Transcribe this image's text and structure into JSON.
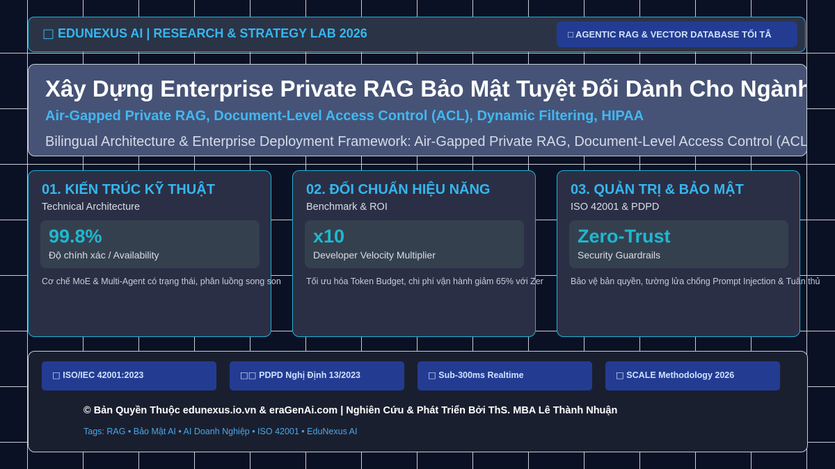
{
  "header": {
    "brand_icon": "□",
    "brand_text": "EDUNEXUS AI | RESEARCH & STRATEGY LAB 2026",
    "pill_text": "□ AGENTIC RAG & VECTOR DATABASE TỐI TÂ"
  },
  "hero": {
    "title": "Xây Dựng Enterprise Private RAG Bảo Mật Tuyệt Đối Dành Cho Ngành",
    "subtitle": "Air-Gapped Private RAG, Document-Level Access Control (ACL), Dynamic Filtering, HIPAA",
    "description": "Bilingual Architecture & Enterprise Deployment Framework: Air-Gapped Private RAG, Document-Level Access Control (ACL), Dy"
  },
  "cards": [
    {
      "title": "01. KIẾN TRÚC KỸ THUẬT",
      "subtitle": "Technical Architecture",
      "metric_value": "99.8%",
      "metric_label": "Độ chính xác / Availability",
      "description": "Cơ chế MoE & Multi-Agent có trạng thái, phân luồng song son"
    },
    {
      "title": "02. ĐỐI CHUẨN HIỆU NĂNG",
      "subtitle": "Benchmark & ROI",
      "metric_value": "x10",
      "metric_label": "Developer Velocity Multiplier",
      "description": "Tối ưu hóa Token Budget, chi phí vận hành giảm 65% với Zer"
    },
    {
      "title": "03. QUẢN TRỊ & BẢO MẬT",
      "subtitle": "ISO 42001 & PDPD",
      "metric_value": "Zero-Trust",
      "metric_label": "Security Guardrails",
      "description": "Bảo vệ bản quyền, tường lửa chống Prompt Injection & Tuân thủ"
    }
  ],
  "footer": {
    "chips": [
      {
        "icon": "□",
        "label": "ISO/IEC 42001:2023"
      },
      {
        "icon": "□□",
        "label": "PDPD Nghị Định 13/2023"
      },
      {
        "icon": "□",
        "label": "Sub-300ms Realtime"
      },
      {
        "icon": "□",
        "label": "SCALE Methodology 2026"
      }
    ],
    "copyright": "© Bản Quyền Thuộc edunexus.io.vn & eraGenAi.com | Nghiên Cứu & Phát Triển Bởi ThS. MBA Lê Thành Nhuận",
    "tags": "Tags: RAG • Bảo Mật AI • AI Doanh Nghiệp • ISO 42001 • EduNexus AI"
  },
  "colors": {
    "background": "#0b1124",
    "accent_cyan": "#35b6ef",
    "metric_teal": "#1fb8cf",
    "pill_blue": "#233c92",
    "hero_panel": "#465376",
    "card_panel": "#2a2f45"
  }
}
